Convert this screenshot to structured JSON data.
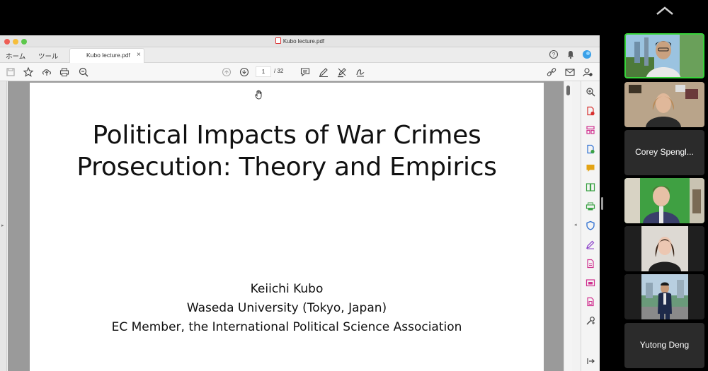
{
  "window": {
    "title": "Kubo lecture.pdf",
    "menu_home": "ホーム",
    "menu_tools": "ツール",
    "tab_label": "Kubo lecture.pdf",
    "tab_close": "×"
  },
  "toolbar": {
    "current_page": "1",
    "total_pages": "/ 32"
  },
  "slide": {
    "title": "Political Impacts of War Crimes Prosecution: Theory and Empirics",
    "author_name": "Keiichi Kubo",
    "author_affiliation": "Waseda University (Tokyo, Japan)",
    "author_role": "EC Member, the International Political Science Association"
  },
  "participants": [
    {
      "name": "",
      "video": true,
      "active": true
    },
    {
      "name": "",
      "video": true,
      "active": false
    },
    {
      "name": "Corey Spengl...",
      "video": false,
      "active": false
    },
    {
      "name": "",
      "video": true,
      "active": false
    },
    {
      "name": "",
      "video": true,
      "active": false
    },
    {
      "name": "",
      "video": true,
      "active": false
    },
    {
      "name": "Yutong Deng",
      "video": false,
      "active": false
    }
  ],
  "colors": {
    "active_speaker_border": "#37d43a",
    "acrobat_red": "#d8302f",
    "acrobat_pink": "#d1318f",
    "acrobat_yellow": "#e3a314",
    "acrobat_green": "#3aa244",
    "acrobat_blue": "#2e6fd1",
    "acrobat_purple": "#8a3ec9"
  },
  "icons": {
    "left_toolbar": [
      "save-icon",
      "star-icon",
      "upload-icon",
      "print-icon",
      "zoom-out-icon"
    ],
    "center_toolbar": [
      "page-up-icon",
      "page-down-icon",
      "comment-icon",
      "pen-icon",
      "highlight-icon",
      "sign-icon"
    ],
    "right_toolbar": [
      "share-link-icon",
      "mail-icon",
      "account-icon"
    ],
    "right_panel": [
      "zoom-search-icon",
      "create-pdf-icon",
      "organize-pages-icon",
      "edit-pdf-icon",
      "comment-tool-icon",
      "combine-icon",
      "print-production-icon",
      "protect-icon",
      "fill-sign-icon",
      "export-pdf-icon",
      "send-review-icon",
      "scan-icon",
      "more-tools-icon",
      "expand-panel-icon"
    ]
  }
}
